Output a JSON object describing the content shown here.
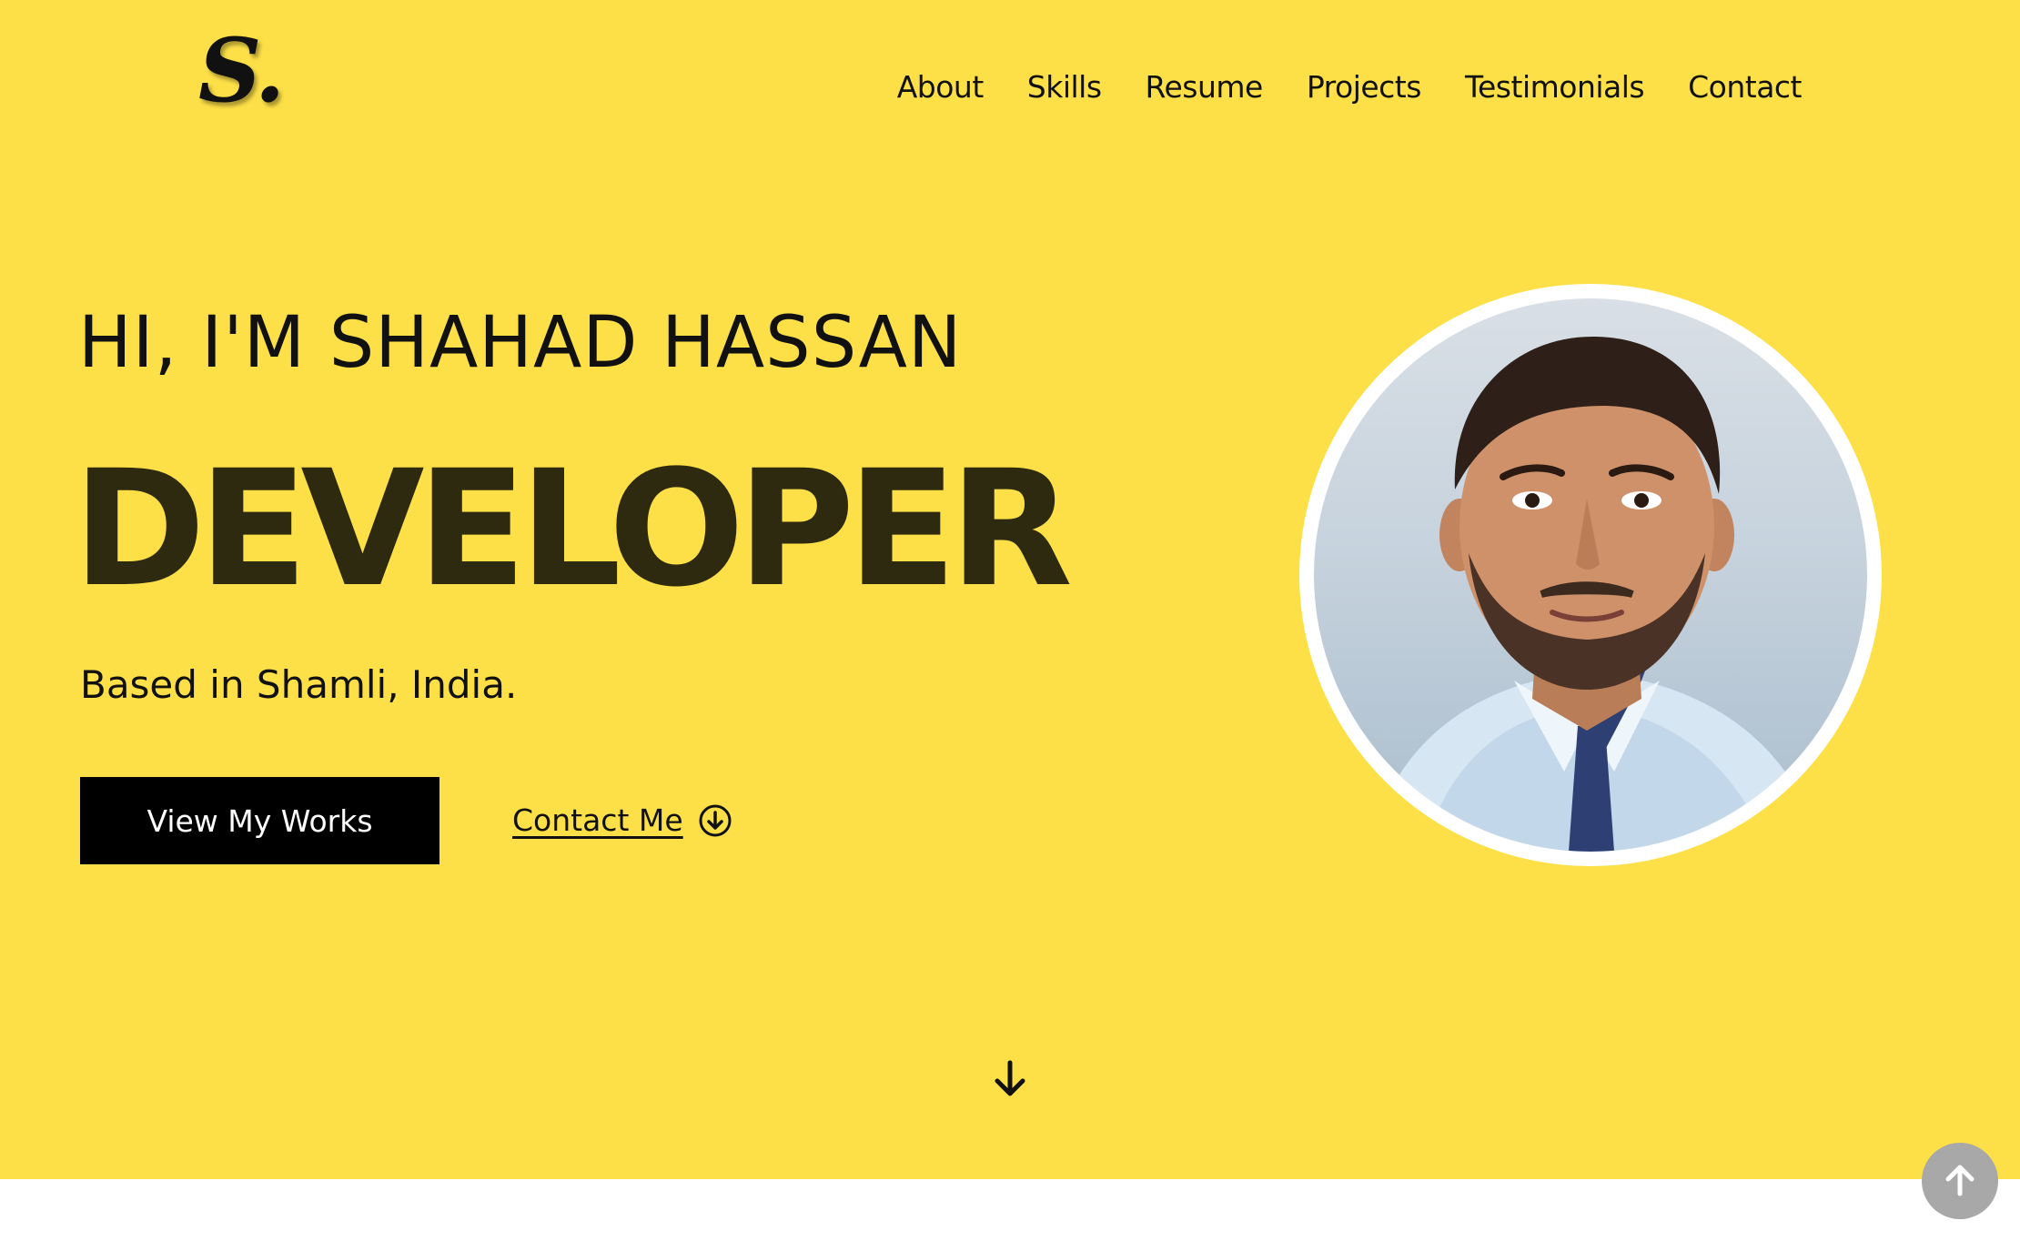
{
  "header": {
    "logo": "S.",
    "nav": [
      "About",
      "Skills",
      "Resume",
      "Projects",
      "Testimonials",
      "Contact"
    ]
  },
  "hero": {
    "greeting": "HI, I'M SHAHAD HASSAN",
    "role": "DEVELOPER",
    "location": "Based in Shamli, India.",
    "primary_button": "View My Works",
    "secondary_link": "Contact Me",
    "secondary_link_icon": "arrow-down-circle-icon",
    "scroll_icon": "arrow-down-icon"
  },
  "back_to_top_icon": "arrow-up-icon",
  "colors": {
    "hero_background": "#fde047",
    "role_text": "#2e2a10",
    "button_background": "#000000",
    "back_to_top_background": "#a8a8a8"
  }
}
